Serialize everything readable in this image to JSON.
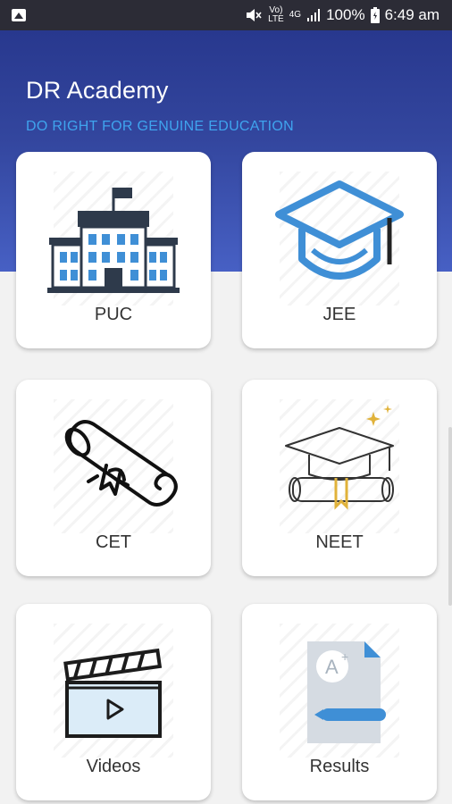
{
  "status_bar": {
    "net_top": "Vo)",
    "net_bottom": "LTE",
    "signal_label": "4G",
    "battery_percent": "100%",
    "time": "6:49 am"
  },
  "header": {
    "title": "DR Academy",
    "subtitle": "DO RIGHT FOR GENUINE EDUCATION"
  },
  "cards": [
    {
      "label": "PUC",
      "icon": "school-building-icon"
    },
    {
      "label": "JEE",
      "icon": "graduation-cap-icon"
    },
    {
      "label": "CET",
      "icon": "diploma-scroll-icon"
    },
    {
      "label": "NEET",
      "icon": "cap-and-diploma-icon"
    },
    {
      "label": "Videos",
      "icon": "clapperboard-video-icon"
    },
    {
      "label": "Results",
      "icon": "grade-sheet-icon"
    }
  ],
  "colors": {
    "status_bar": "#2c2c36",
    "header_top": "#28388e",
    "header_bottom": "#4760c4",
    "subtitle": "#3fa4ee",
    "icon_blue": "#3f8fd6",
    "icon_dark": "#2e3a4b"
  }
}
